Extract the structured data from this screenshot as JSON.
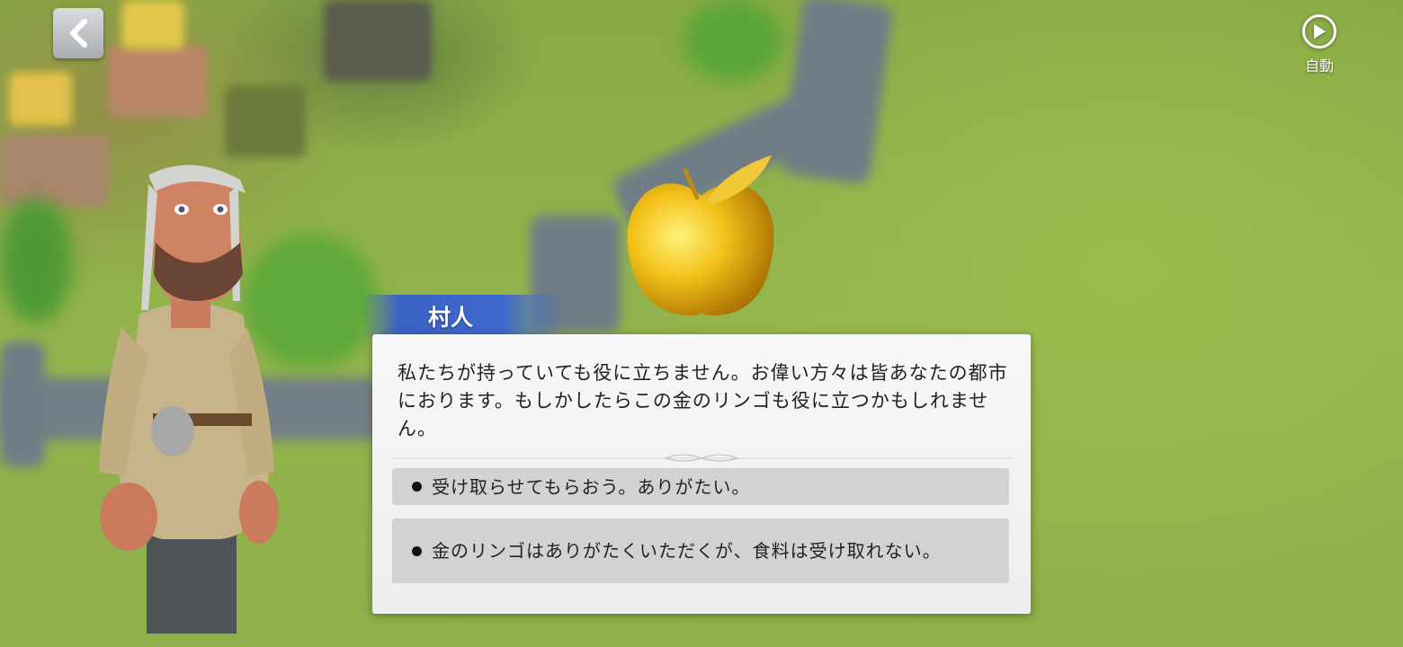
{
  "hud": {
    "back_icon": "chevron-left-icon",
    "auto_icon": "play-circle-icon",
    "auto_label": "自動"
  },
  "dialog": {
    "speaker": "村人",
    "message": "私たちが持っていても役に立ちません。お偉い方々は皆あなたの都市におります。もしかしたらこの金のリンゴも役に立つかもしれません。",
    "options": [
      {
        "label": "受け取らせてもらおう。ありがたい。"
      },
      {
        "label": "金のリンゴはありがたくいただくが、食料は受け取れない。"
      }
    ]
  },
  "colors": {
    "name_tab": "#3f69cc",
    "dialog_bg": "#f2f2f2",
    "option_bg": "#d2d2d2",
    "apple_gold": "#f2c21a"
  }
}
